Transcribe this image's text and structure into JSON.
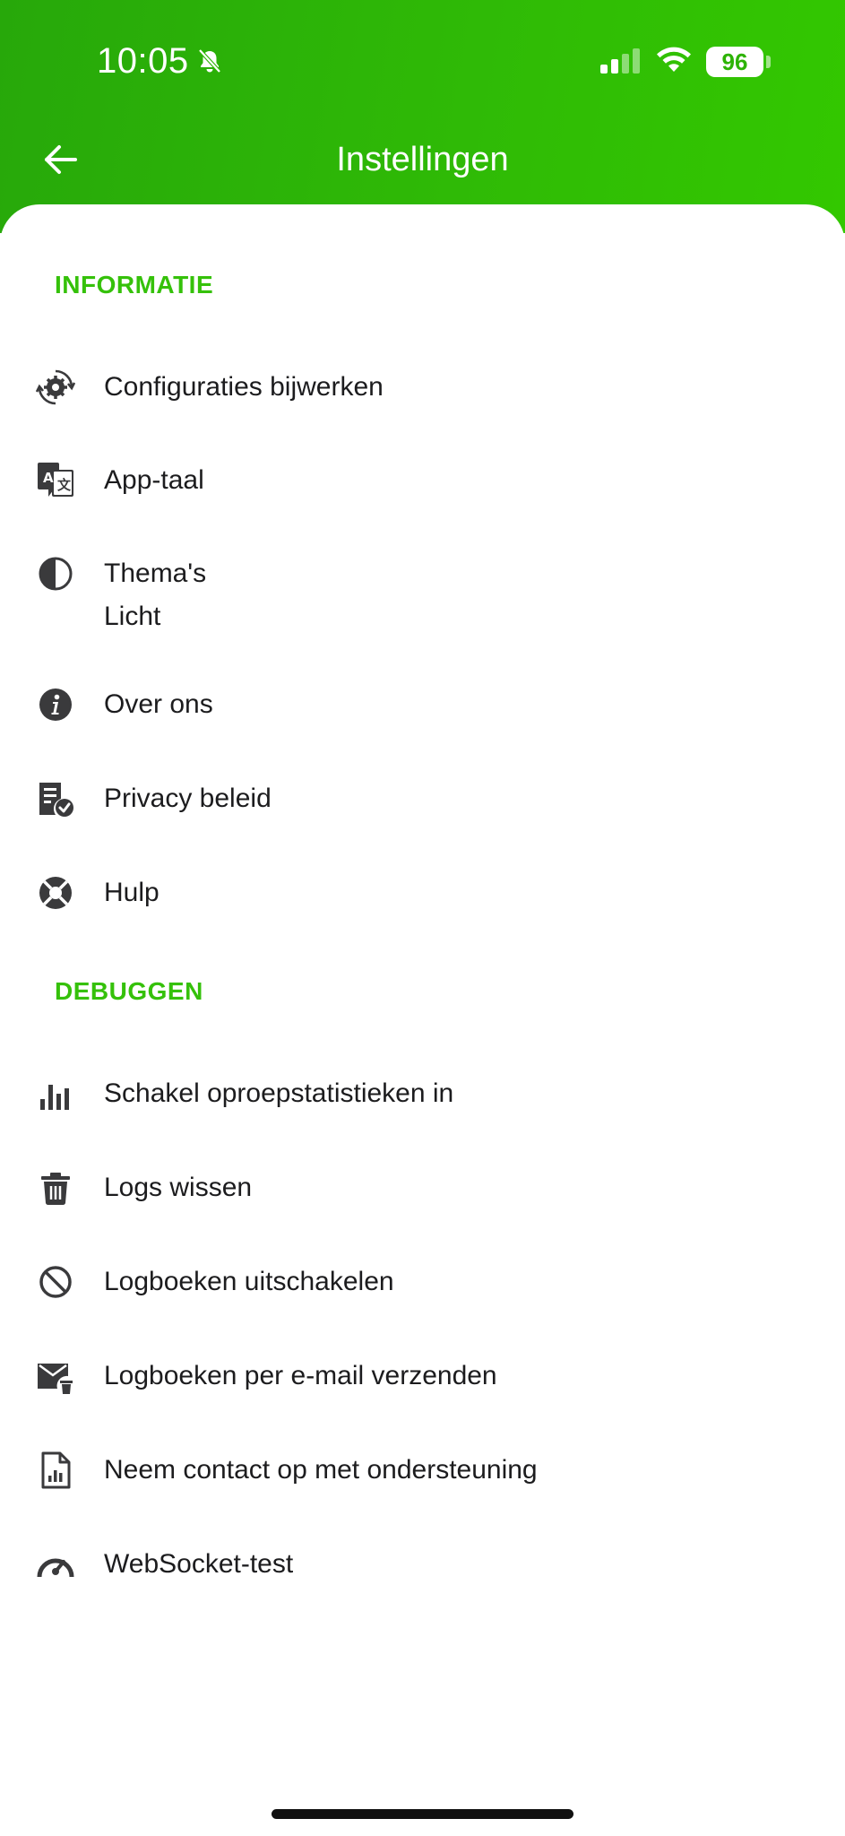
{
  "status_bar": {
    "time": "10:05",
    "battery": "96",
    "icons": [
      "bell-slash-icon",
      "signal-icon",
      "wifi-icon",
      "battery-icon"
    ]
  },
  "header": {
    "title": "Instellingen",
    "back_icon": "arrow-left-icon"
  },
  "sections": {
    "info": {
      "title": "INFORMATIE",
      "items": [
        {
          "label": "Configuraties bijwerken",
          "icon": "settings-sync-icon"
        },
        {
          "label": "App-taal",
          "icon": "translate-icon"
        },
        {
          "label": "Thema's",
          "sublabel": "Licht",
          "icon": "contrast-icon"
        },
        {
          "label": "Over ons",
          "icon": "info-icon"
        },
        {
          "label": "Privacy beleid",
          "icon": "privacy-policy-icon"
        },
        {
          "label": "Hulp",
          "icon": "lifebuoy-icon"
        }
      ]
    },
    "debug": {
      "title": "DEBUGGEN",
      "items": [
        {
          "label": "Schakel oproepstatistieken in",
          "icon": "bar-chart-icon"
        },
        {
          "label": "Logs wissen",
          "icon": "trash-icon"
        },
        {
          "label": "Logboeken uitschakelen",
          "icon": "block-icon"
        },
        {
          "label": "Logboeken per e-mail verzenden",
          "icon": "mail-delete-icon"
        },
        {
          "label": "Neem contact op met ondersteuning",
          "icon": "report-file-icon"
        },
        {
          "label": "WebSocket-test",
          "icon": "speedometer-icon"
        }
      ]
    }
  },
  "colors": {
    "header_green": "#2db305",
    "section_green": "#35c10a",
    "text": "#1c1c1e",
    "icon": "#3a3a3c"
  }
}
